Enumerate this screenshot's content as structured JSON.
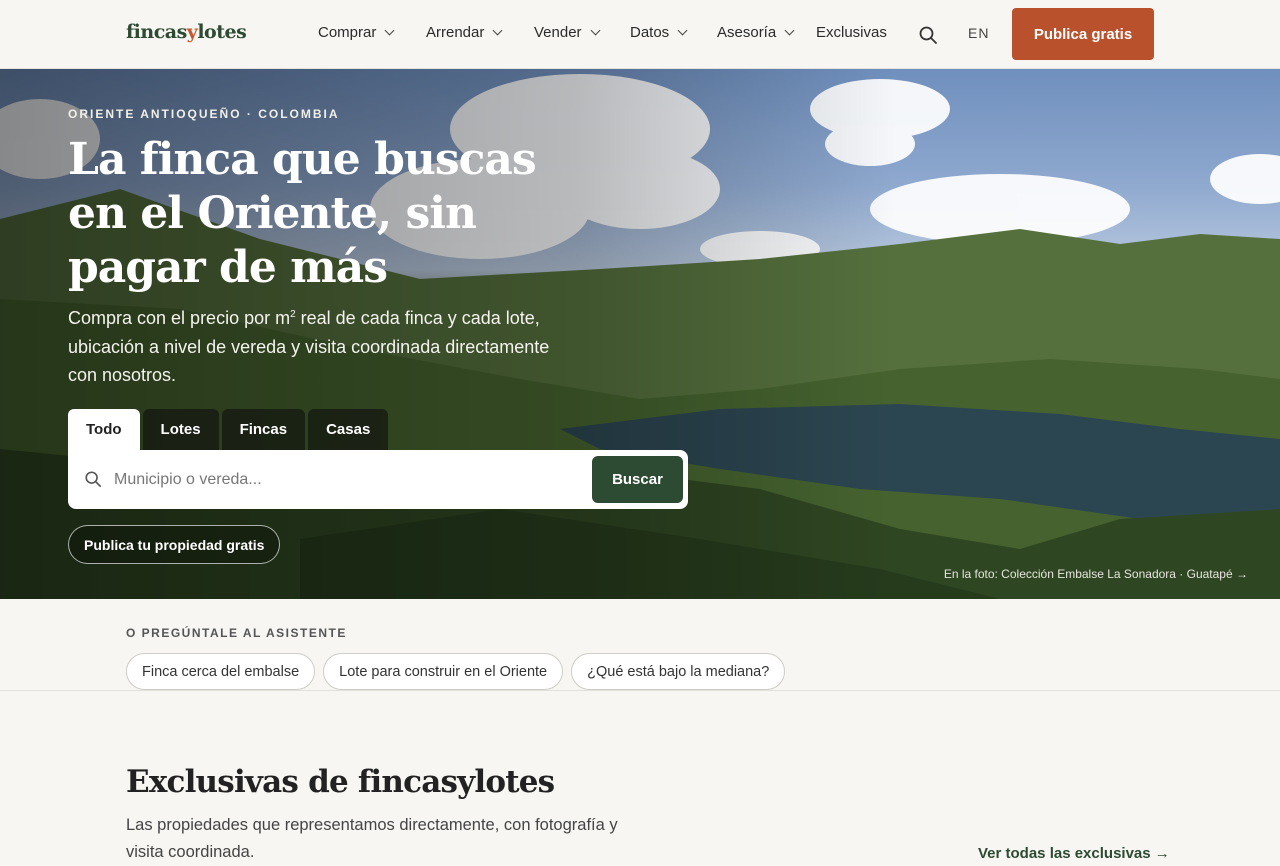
{
  "header": {
    "logo_main": "fincas",
    "logo_y": "y",
    "logo_end": "lotes",
    "nav": [
      {
        "label": "Comprar",
        "dropdown": true
      },
      {
        "label": "Arrendar",
        "dropdown": true
      },
      {
        "label": "Vender",
        "dropdown": true
      },
      {
        "label": "Datos",
        "dropdown": true
      },
      {
        "label": "Asesoría",
        "dropdown": true
      },
      {
        "label": "Exclusivas",
        "dropdown": false
      }
    ],
    "lang": "EN",
    "cta": "Publica gratis"
  },
  "hero": {
    "eyebrow": "ORIENTE ANTIOQUEÑO · COLOMBIA",
    "title": "La finca que buscas en el Oriente, sin pagar de más",
    "sub_part1": "Compra con el precio por m",
    "sub_sup": "2",
    "sub_part2": " real de cada finca y cada lote, ubicación a nivel de vereda y visita coordinada directamente con nosotros.",
    "tabs": [
      "Todo",
      "Lotes",
      "Fincas",
      "Casas"
    ],
    "active_tab": "Todo",
    "search_placeholder": "Municipio o vereda...",
    "search_button": "Buscar",
    "publish_pill": "Publica tu propiedad gratis",
    "photo_credit": "En la foto: Colección Embalse La Sonadora · Guatapé →"
  },
  "assistant": {
    "label": "O PREGÚNTALE AL ASISTENTE",
    "chips": [
      "Finca cerca del embalse",
      "Lote para construir en el Oriente",
      "¿Qué está bajo la mediana?"
    ]
  },
  "exclusives": {
    "title": "Exclusivas de fincasylotes",
    "subtitle": "Las propiedades que representamos directamente, con fotografía y visita coordinada.",
    "see_all": "Ver todas las exclusivas →"
  },
  "colors": {
    "brand_green": "#2d4a32",
    "accent_orange": "#b9512d",
    "background": "#f7f6f2"
  }
}
